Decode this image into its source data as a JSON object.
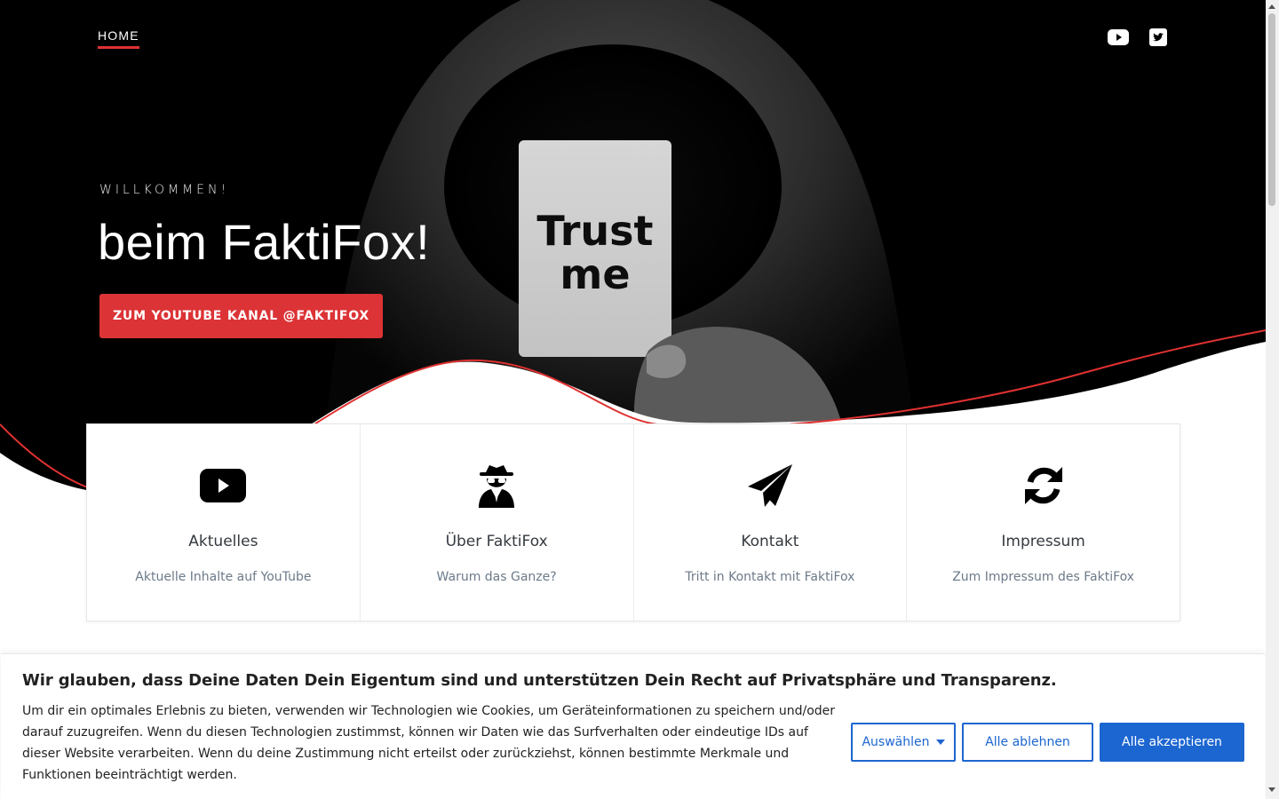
{
  "nav": {
    "home_label": "HOME"
  },
  "social": [
    {
      "icon": "youtube-icon"
    },
    {
      "icon": "twitter-icon"
    }
  ],
  "hero": {
    "eyebrow": "WILLKOMMEN!",
    "title": "beim FaktiFox!",
    "cta_label": "ZUM YOUTUBE KANAL @FAKTIFOX",
    "card_text": [
      "Trust",
      "me"
    ]
  },
  "features": [
    {
      "icon": "youtube-play-icon",
      "title": "Aktuelles",
      "subtitle": "Aktuelle Inhalte auf YouTube"
    },
    {
      "icon": "user-secret-icon",
      "title": "Über FaktiFox",
      "subtitle": "Warum das Ganze?"
    },
    {
      "icon": "paper-plane-icon",
      "title": "Kontakt",
      "subtitle": "Tritt in Kontakt mit FaktiFox"
    },
    {
      "icon": "refresh-icon",
      "title": "Impressum",
      "subtitle": "Zum Impressum des FaktiFox"
    }
  ],
  "cookie": {
    "title": "Wir glauben, dass Deine Daten Dein Eigentum sind und unterstützen Dein Recht auf Privatsphäre und Transparenz.",
    "text": "Um dir ein optimales Erlebnis zu bieten, verwenden wir Technologien wie Cookies, um Geräteinformationen zu speichern und/oder darauf zuzugreifen. Wenn du diesen Technologien zustimmst, können wir Daten wie das Surfverhalten oder eindeutige IDs auf dieser Website verarbeiten. Wenn du deine Zustimmung nicht erteilst oder zurückziehst, können bestimmte Merkmale und Funktionen beeinträchtigt werden.",
    "select_label": "Auswählen",
    "deny_label": "Alle ablehnen",
    "accept_label": "Alle akzeptieren"
  },
  "colors": {
    "accent_red": "#dc3336",
    "primary_blue": "#1c66d1",
    "hero_bg": "#000000"
  }
}
